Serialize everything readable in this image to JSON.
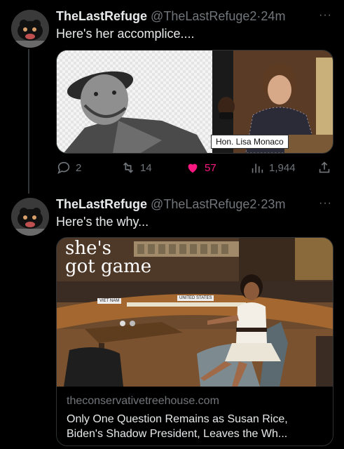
{
  "tweet1": {
    "display_name": "TheLastRefuge",
    "handle": "@TheLastRefuge2",
    "separator": "·",
    "time": "24m",
    "text": "Here's her accomplice....",
    "image_caption": "Hon. Lisa Monaco",
    "stats": {
      "replies": "2",
      "retweets": "14",
      "likes": "57",
      "views": "1,944"
    }
  },
  "tweet2": {
    "display_name": "TheLastRefuge",
    "handle": "@TheLastRefuge2",
    "separator": "·",
    "time": "23m",
    "text": "Here's the why...",
    "image_overlay_line1": "she's",
    "image_overlay_line2": "got game",
    "placard_left": "VIET NAM",
    "placard_right": "UNITED STATES",
    "link_domain": "theconservativetreehouse.com",
    "link_title": "Only One Question Remains as Susan Rice, Biden's Shadow President, Leaves the Wh..."
  },
  "more_glyph": "···",
  "colors": {
    "background": "#000000",
    "text": "#e7e9ea",
    "muted": "#71767b",
    "like": "#f91880",
    "border": "#2f3336"
  }
}
